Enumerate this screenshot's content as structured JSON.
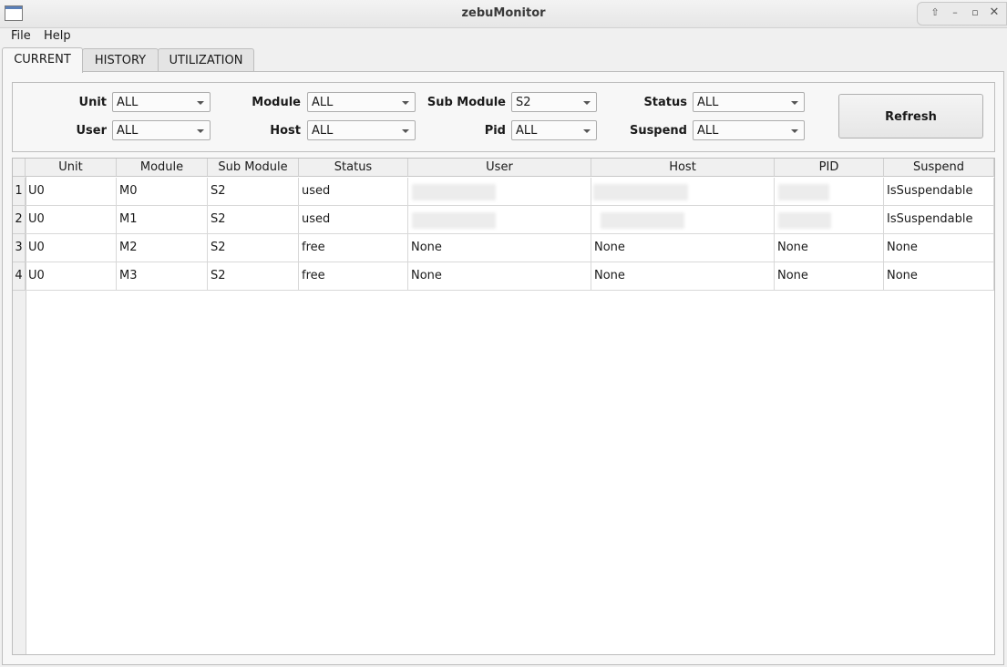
{
  "window": {
    "title": "zebuMonitor"
  },
  "menu": {
    "file": "File",
    "help": "Help"
  },
  "tabs": [
    {
      "label": "CURRENT"
    },
    {
      "label": "HISTORY"
    },
    {
      "label": "UTILIZATION"
    }
  ],
  "filters": {
    "unit": {
      "label": "Unit",
      "value": "ALL"
    },
    "module": {
      "label": "Module",
      "value": "ALL"
    },
    "sub_module": {
      "label": "Sub Module",
      "value": "S2"
    },
    "status": {
      "label": "Status",
      "value": "ALL"
    },
    "user": {
      "label": "User",
      "value": "ALL"
    },
    "host": {
      "label": "Host",
      "value": "ALL"
    },
    "pid": {
      "label": "Pid",
      "value": "ALL"
    },
    "suspend": {
      "label": "Suspend",
      "value": "ALL"
    }
  },
  "refresh_label": "Refresh",
  "table": {
    "headers": [
      "Unit",
      "Module",
      "Sub Module",
      "Status",
      "User",
      "Host",
      "PID",
      "Suspend"
    ],
    "rows": [
      {
        "num": "1",
        "cells": [
          "U0",
          "M0",
          "S2",
          "used",
          "",
          "",
          "",
          "IsSuspendable"
        ]
      },
      {
        "num": "2",
        "cells": [
          "U0",
          "M1",
          "S2",
          "used",
          "",
          "",
          "",
          "IsSuspendable"
        ]
      },
      {
        "num": "3",
        "cells": [
          "U0",
          "M2",
          "S2",
          "free",
          "None",
          "None",
          "None",
          "None"
        ]
      },
      {
        "num": "4",
        "cells": [
          "U0",
          "M3",
          "S2",
          "free",
          "None",
          "None",
          "None",
          "None"
        ]
      }
    ]
  }
}
